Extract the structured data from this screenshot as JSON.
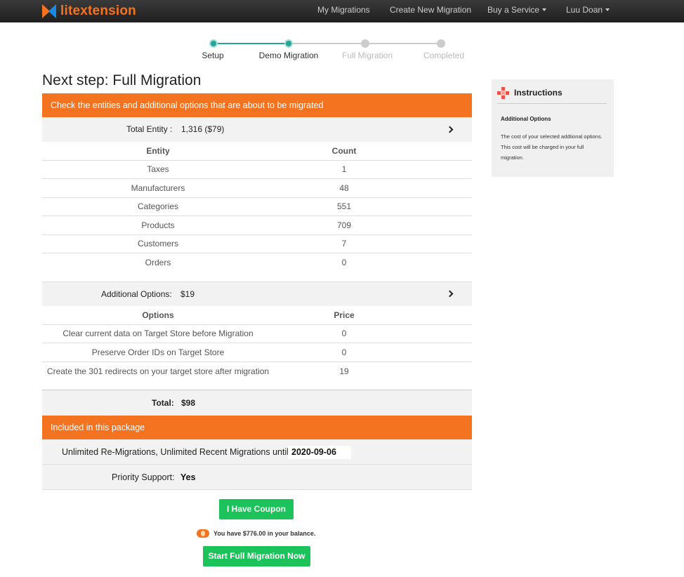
{
  "brand": {
    "lit": "lit",
    "ext": "extension",
    "primary_color": "#f47321"
  },
  "nav": {
    "my_migrations": "My Migrations",
    "create_new": "Create New Migration",
    "buy_service": "Buy a Service",
    "user": "Luu Doan"
  },
  "stepper": {
    "steps": [
      {
        "label": "Setup",
        "status": "done"
      },
      {
        "label": "Demo Migration",
        "status": "done"
      },
      {
        "label": "Full Migration",
        "status": "pending"
      },
      {
        "label": "Completed",
        "status": "pending"
      }
    ]
  },
  "page_title": "Next step: Full Migration",
  "entities_banner": "Check the entities and additional options that are about to be migrated",
  "total_entity": {
    "label": "Total Entity :",
    "value": "1,316 ($79)"
  },
  "entity_table": {
    "headers": [
      "Entity",
      "Count"
    ],
    "rows": [
      [
        "Taxes",
        "1"
      ],
      [
        "Manufacturers",
        "48"
      ],
      [
        "Categories",
        "551"
      ],
      [
        "Products",
        "709"
      ],
      [
        "Customers",
        "7"
      ],
      [
        "Orders",
        "0"
      ]
    ]
  },
  "additional_options": {
    "label": "Additional Options:",
    "value": "$19"
  },
  "options_table": {
    "headers": [
      "Options",
      "Price"
    ],
    "rows": [
      [
        "Clear current data on Target Store before Migration",
        "0"
      ],
      [
        "Preserve Order IDs on Target Store",
        "0"
      ],
      [
        "Create the 301 redirects on your target store after migration",
        "19"
      ]
    ]
  },
  "total": {
    "label": "Total:",
    "value": "$98"
  },
  "package_banner": "Included in this package",
  "package": {
    "remigrations_label": "Unlimited Re-Migrations, Unlimited Recent Migrations until:",
    "remigrations_date": "2020-09-06",
    "support_label": "Priority Support:",
    "support_value": "Yes"
  },
  "coupon_button": "I Have Coupon",
  "balance_text": "You have $776.00 in your balance.",
  "start_button": "Start Full Migration Now",
  "instructions": {
    "title": "Instructions",
    "subtitle": "Additional Options",
    "text": "The cost of your selected addtional options. This cost will be charged in your full migration."
  }
}
